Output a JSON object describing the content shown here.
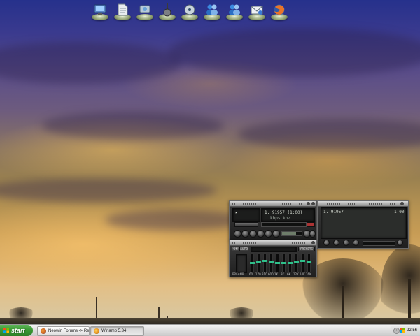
{
  "dock": {
    "items": [
      {
        "name": "my-computer",
        "icon": "monitor-icon"
      },
      {
        "name": "documents",
        "icon": "document-icon"
      },
      {
        "name": "network",
        "icon": "network-icon"
      },
      {
        "name": "guitar",
        "icon": "guitar-icon"
      },
      {
        "name": "media",
        "icon": "media-icon"
      },
      {
        "name": "messenger-1",
        "icon": "messenger-icon"
      },
      {
        "name": "messenger-2",
        "icon": "messenger-icon"
      },
      {
        "name": "mail",
        "icon": "mail-icon"
      },
      {
        "name": "firefox",
        "icon": "firefox-icon"
      }
    ]
  },
  "winamp": {
    "main": {
      "track_line": "1. 91957 (1:00)",
      "bitrate_label": "kbps",
      "khz_label": "khz",
      "progress": 0.02
    },
    "video": {
      "track": "1. 91957",
      "time": "1:00"
    },
    "eq": {
      "on_label": "ON",
      "auto_label": "AUTO",
      "presets_label": "PRESETS",
      "preamp_label": "PREAMP",
      "band_levels": [
        0.5,
        0.55,
        0.6,
        0.55,
        0.5,
        0.5,
        0.5,
        0.55,
        0.6,
        0.55
      ],
      "band_labels": [
        "60",
        "170",
        "310",
        "600",
        "1K",
        "3K",
        "6K",
        "12K",
        "14K",
        "16K"
      ]
    }
  },
  "taskbar": {
    "start_label": "start",
    "tasks": [
      {
        "label": "Neowin Forums -> Re...",
        "icon": "firefox-icon",
        "active": false
      },
      {
        "label": "Winamp 5.34",
        "icon": "winamp-icon",
        "active": true
      }
    ],
    "clock": "22:56"
  },
  "colors": {
    "taskbar": "#d8d8d8",
    "start_button": "#3a9a34",
    "lcd_text": "#d6dbd2",
    "eq_knob": "#2fbf8a"
  }
}
